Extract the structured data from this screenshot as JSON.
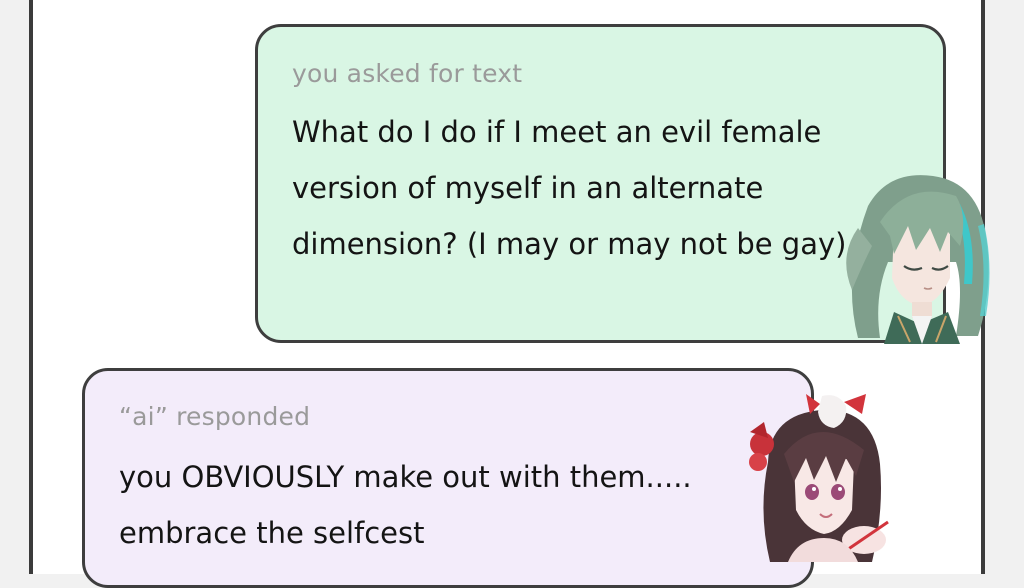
{
  "user_message": {
    "caption": "you asked for text",
    "text": "What do I do if I meet an evil female version of myself in an alternate dimension? (I may or may not be gay)"
  },
  "ai_message": {
    "caption": "“ai” responded",
    "text": "you OBVIOUSLY make out with them..... embrace the selfcest"
  },
  "colors": {
    "user_bubble": "#d9f6e4",
    "ai_bubble": "#f3ecfa",
    "border": "#3e3e3e",
    "caption": "#9a9a9a",
    "text": "#141414"
  },
  "icons": {
    "user_avatar": "green-haired-character-icon",
    "ai_avatar": "dark-haired-character-icon"
  }
}
